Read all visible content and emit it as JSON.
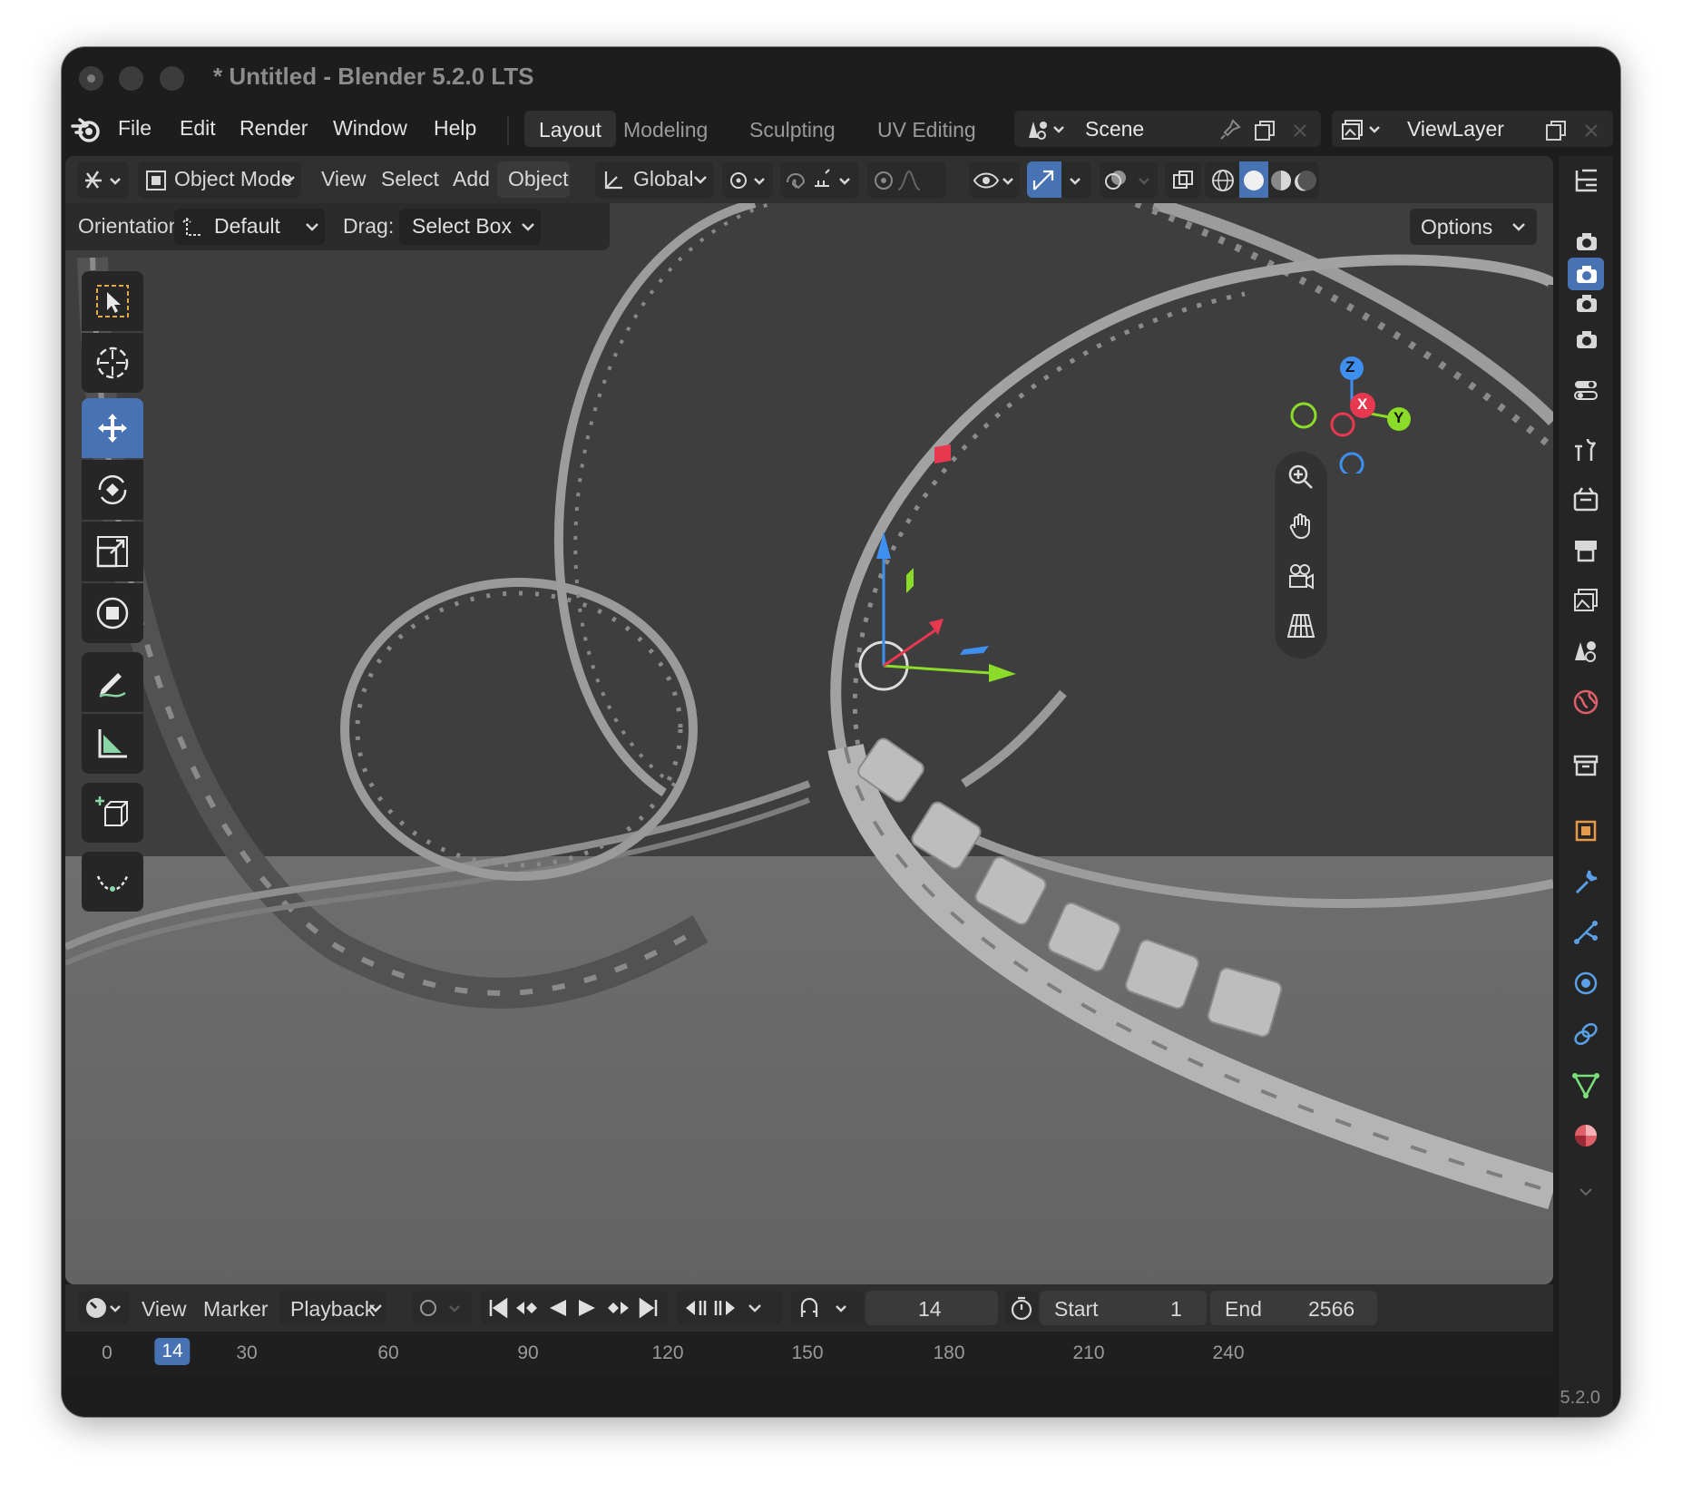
{
  "window": {
    "title": "* Untitled - Blender 5.2.0 LTS",
    "version": "5.2.0"
  },
  "menu": {
    "file": "File",
    "edit": "Edit",
    "render": "Render",
    "window": "Window",
    "help": "Help"
  },
  "workspaces": [
    {
      "label": "Layout",
      "active": true
    },
    {
      "label": "Modeling",
      "active": false
    },
    {
      "label": "Sculpting",
      "active": false
    },
    {
      "label": "UV Editing",
      "active": false
    }
  ],
  "scene": {
    "name": "Scene"
  },
  "view_layer": {
    "name": "ViewLayer"
  },
  "viewport_header": {
    "mode": "Object Mode",
    "view": "View",
    "select": "Select",
    "add": "Add",
    "object": "Object",
    "orientation_global": "Global"
  },
  "tool_settings": {
    "orientation_label": "Orientation:",
    "orientation_value": "Default",
    "drag_label": "Drag:",
    "drag_value": "Select Box",
    "options": "Options"
  },
  "gizmo": {
    "z": "Z",
    "x": "X",
    "y": "Y"
  },
  "timeline": {
    "view": "View",
    "marker": "Marker",
    "playback": "Playback",
    "current_frame": "14",
    "start_label": "Start",
    "start_value": "1",
    "end_label": "End",
    "end_value": "2566",
    "ticks": [
      "0",
      "14",
      "30",
      "60",
      "90",
      "120",
      "150",
      "180",
      "210",
      "240"
    ]
  },
  "colors": {
    "accent": "#4772b3",
    "axis_x": "#e8384f",
    "axis_y": "#8bdc28",
    "axis_z": "#3f8ff0"
  }
}
